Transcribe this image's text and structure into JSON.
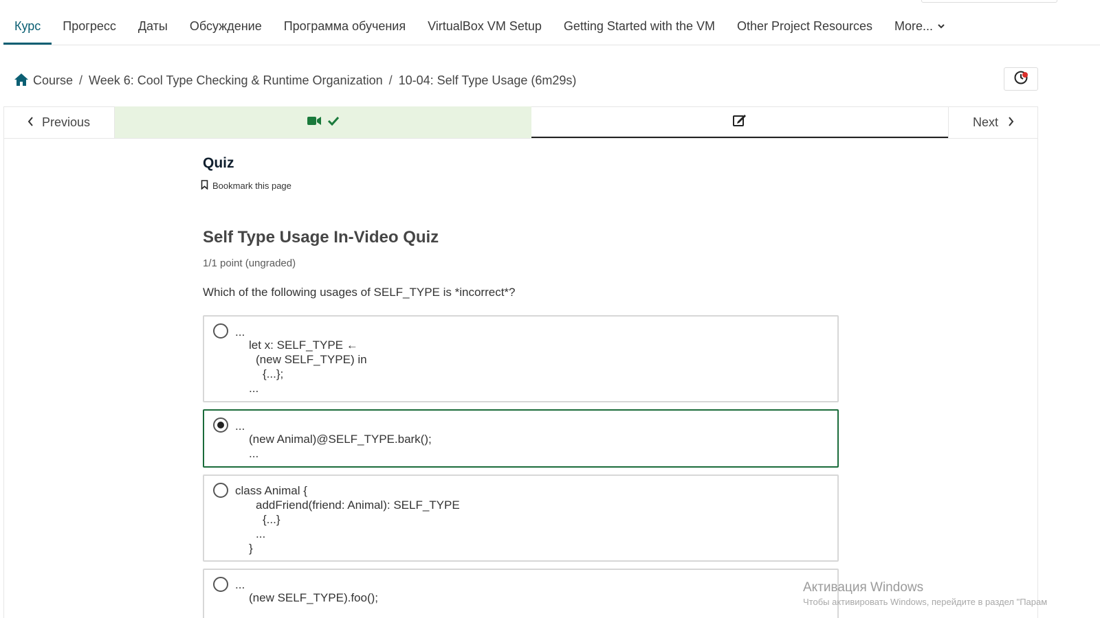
{
  "course_nav": {
    "tabs": [
      {
        "label": "Курс"
      },
      {
        "label": "Прогресс"
      },
      {
        "label": "Даты"
      },
      {
        "label": "Обсуждение"
      },
      {
        "label": "Программа обучения"
      },
      {
        "label": "VirtualBox VM Setup"
      },
      {
        "label": "Getting Started with the VM"
      },
      {
        "label": "Other Project Resources"
      },
      {
        "label": "More..."
      }
    ],
    "active_index": 0
  },
  "breadcrumb": {
    "home": "Course",
    "section": "Week 6: Cool Type Checking & Runtime Organization",
    "subsection": "10-04: Self Type Usage (6m29s)"
  },
  "sequence": {
    "prev_label": "Previous",
    "next_label": "Next",
    "units": [
      {
        "icon": "video-icon",
        "completed": true,
        "active": false
      },
      {
        "icon": "edit-icon",
        "completed": false,
        "active": true
      }
    ]
  },
  "unit": {
    "title": "Quiz",
    "bookmark_label": "Bookmark this page"
  },
  "problem": {
    "title": "Self Type Usage In-Video Quiz",
    "points": "1/1 point (ungraded)",
    "question": "Which of the following usages of SELF_TYPE is *incorrect*?",
    "options": [
      {
        "selected": false,
        "lines": [
          "...",
          "let x: SELF_TYPE ←",
          "(new SELF_TYPE) in",
          "{...};",
          "..."
        ]
      },
      {
        "selected": true,
        "lines": [
          "...",
          "(new Animal)@SELF_TYPE.bark();",
          "..."
        ]
      },
      {
        "selected": false,
        "lines": [
          "class Animal {",
          "addFriend(friend: Animal): SELF_TYPE",
          "{...}",
          "...",
          "}"
        ]
      },
      {
        "selected": false,
        "lines": [
          "...",
          "(new SELF_TYPE).foo();"
        ]
      }
    ]
  },
  "watermark": {
    "line1": "Активация Windows",
    "line2": "Чтобы активировать Windows, перейдите в раздел \"Парам"
  },
  "colors": {
    "accent": "#0b5f73",
    "selected_border": "#1a6b3a",
    "completed_green": "#1a7a3c",
    "completed_bg": "#e8f3e1"
  }
}
